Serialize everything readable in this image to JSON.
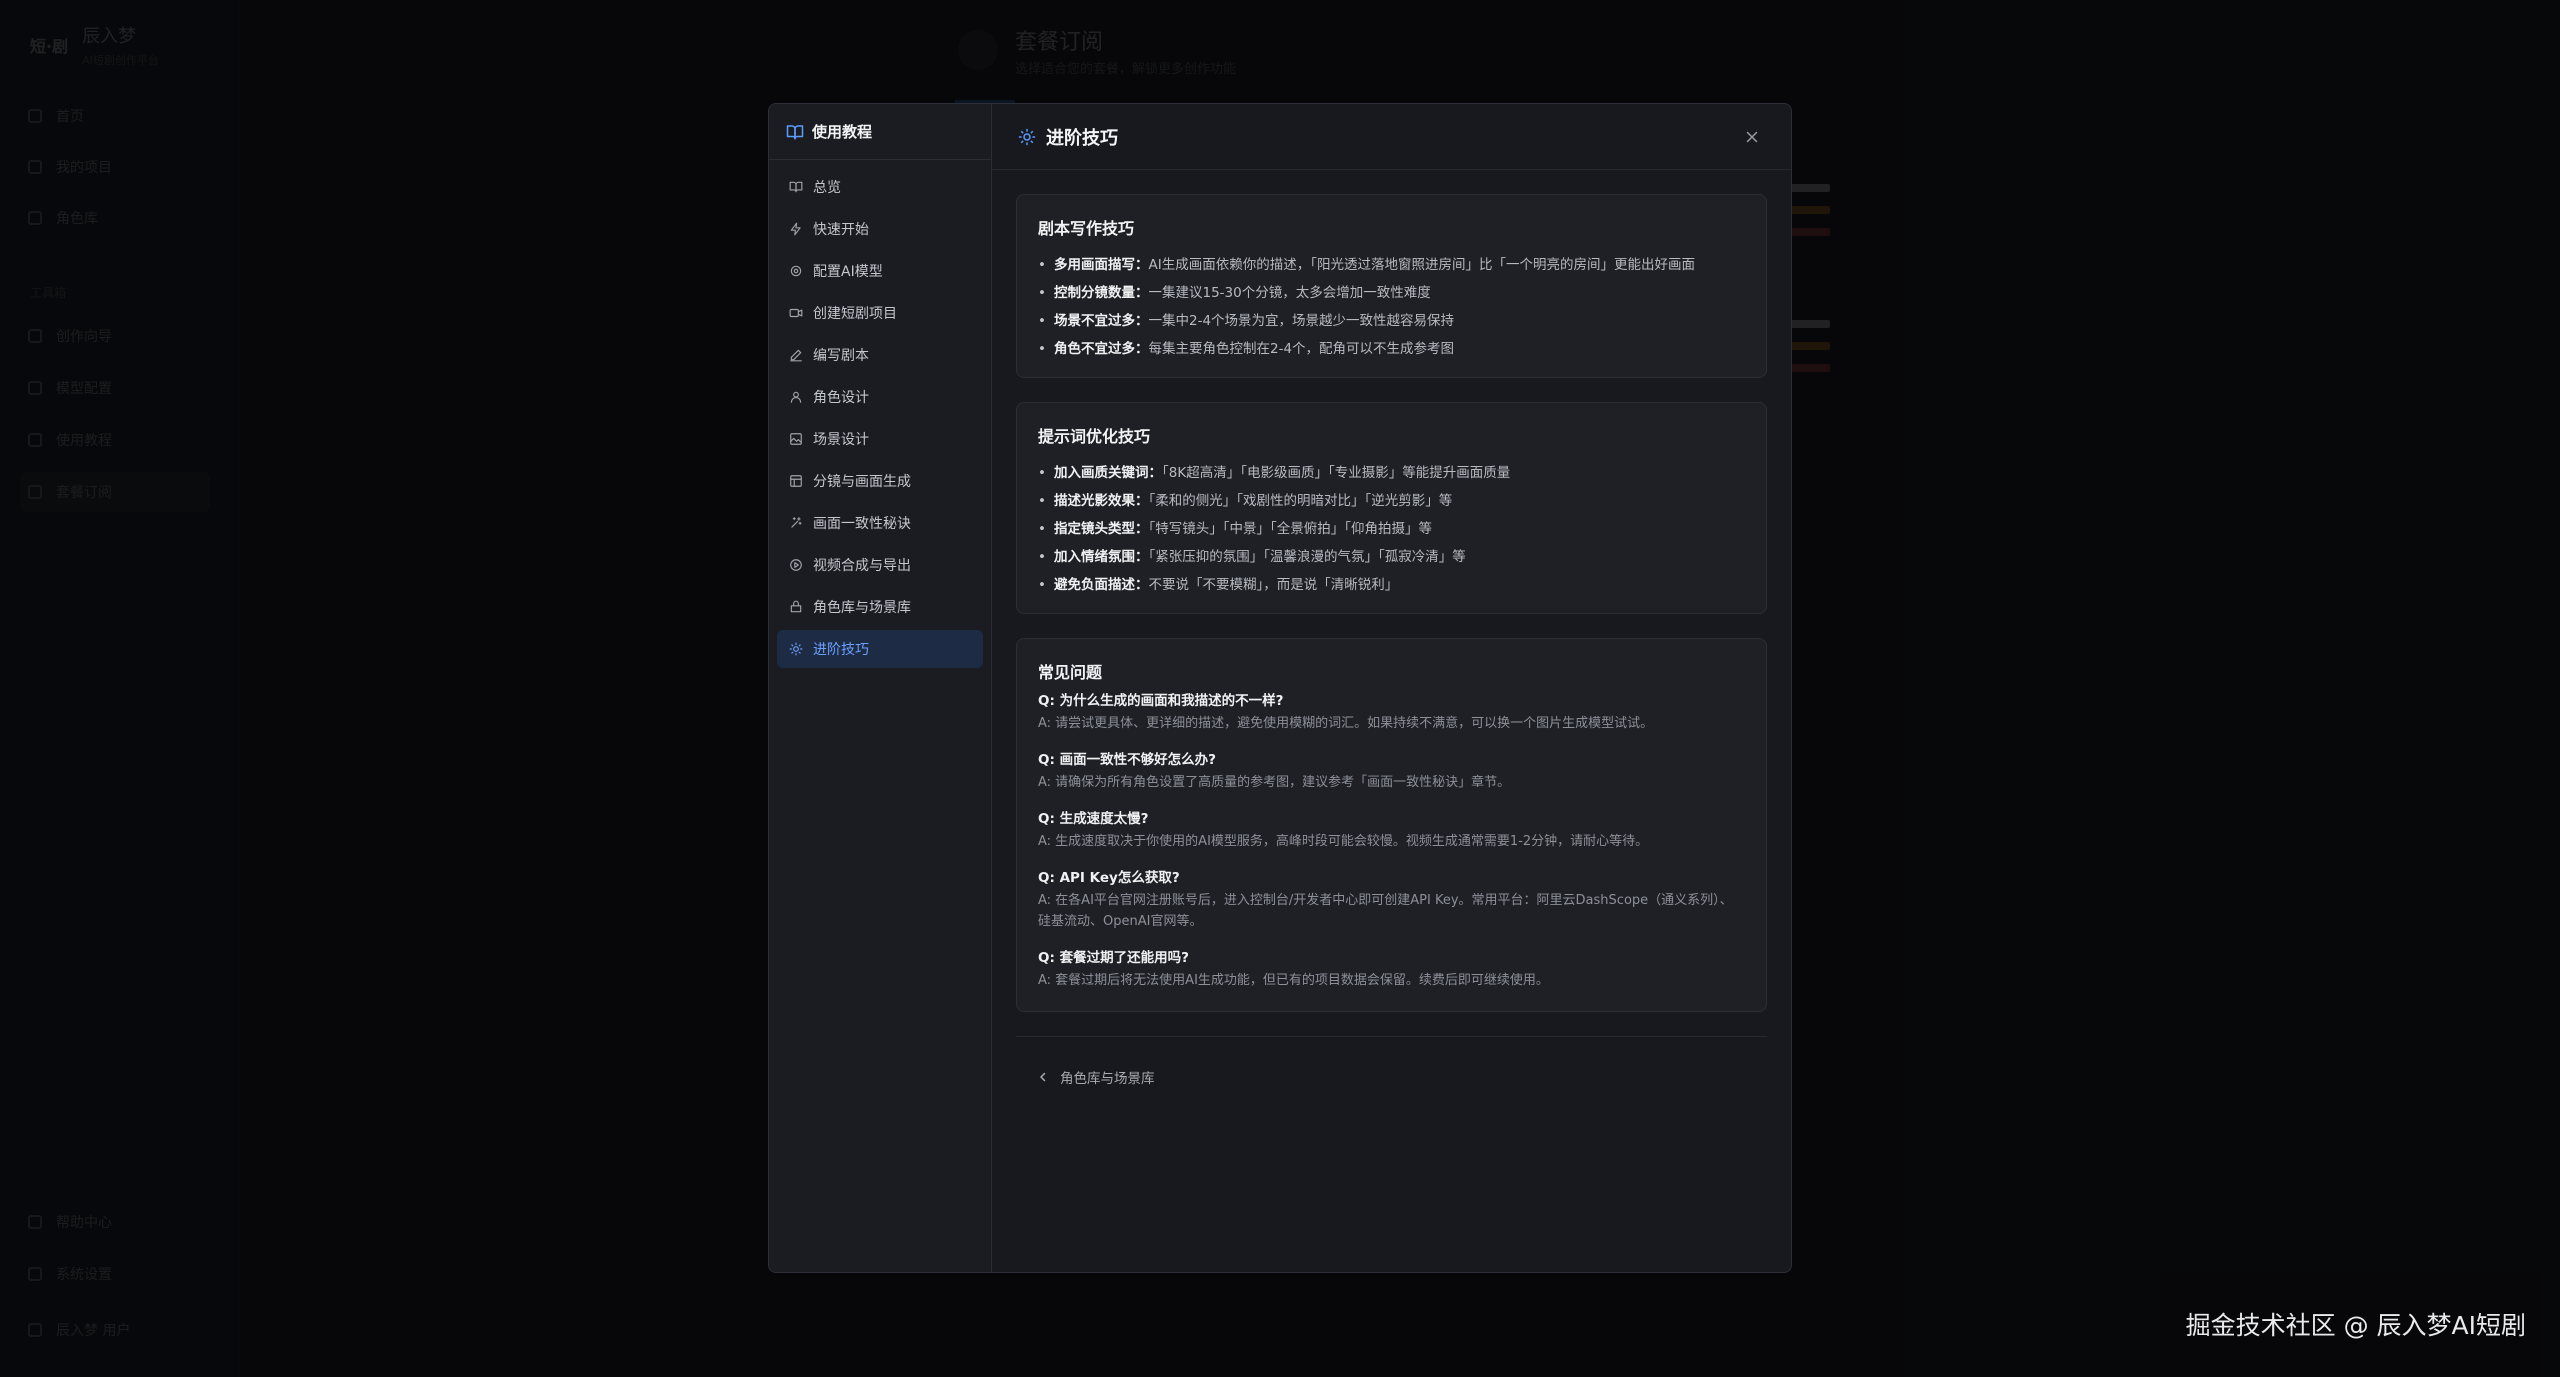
{
  "background": {
    "brand_logo": "短·剧",
    "brand_name": "辰入梦",
    "brand_sub": "AI短剧创作平台",
    "nav": [
      "首页",
      "我的项目",
      "角色库"
    ],
    "section_label": "工具箱",
    "nav2": [
      "创作向导",
      "模型配置",
      "使用教程",
      "套餐订阅"
    ],
    "bottom": [
      "帮助中心",
      "系统设置",
      "辰入梦 用户"
    ],
    "main_title": "套餐订阅",
    "main_sub": "选择适合您的套餐，解锁更多创作功能"
  },
  "modal": {
    "sidebar_title": "使用教程",
    "nav_items": [
      {
        "label": "总览",
        "icon": "book-icon"
      },
      {
        "label": "快速开始",
        "icon": "lightning-icon"
      },
      {
        "label": "配置AI模型",
        "icon": "gear-icon"
      },
      {
        "label": "创建短剧项目",
        "icon": "video-icon"
      },
      {
        "label": "编写剧本",
        "icon": "edit-icon"
      },
      {
        "label": "角色设计",
        "icon": "user-icon"
      },
      {
        "label": "场景设计",
        "icon": "image-icon"
      },
      {
        "label": "分镜与画面生成",
        "icon": "storyboard-icon"
      },
      {
        "label": "画面一致性秘诀",
        "icon": "sparkle-icon"
      },
      {
        "label": "视频合成与导出",
        "icon": "play-icon"
      },
      {
        "label": "角色库与场景库",
        "icon": "library-icon"
      },
      {
        "label": "进阶技巧",
        "icon": "lightbulb-icon",
        "active": true
      }
    ],
    "header_title": "进阶技巧",
    "sections": {
      "script": {
        "title": "剧本写作技巧",
        "tips": [
          {
            "key": "多用画面描写：",
            "text": "AI生成画面依赖你的描述，「阳光透过落地窗照进房间」比「一个明亮的房间」更能出好画面"
          },
          {
            "key": "控制分镜数量：",
            "text": "一集建议15-30个分镜，太多会增加一致性难度"
          },
          {
            "key": "场景不宜过多：",
            "text": "一集中2-4个场景为宜，场景越少一致性越容易保持"
          },
          {
            "key": "角色不宜过多：",
            "text": "每集主要角色控制在2-4个，配角可以不生成参考图"
          }
        ]
      },
      "prompt": {
        "title": "提示词优化技巧",
        "tips": [
          {
            "key": "加入画质关键词：",
            "text": "「8K超高清」「电影级画质」「专业摄影」等能提升画面质量"
          },
          {
            "key": "描述光影效果：",
            "text": "「柔和的侧光」「戏剧性的明暗对比」「逆光剪影」等"
          },
          {
            "key": "指定镜头类型：",
            "text": "「特写镜头」「中景」「全景俯拍」「仰角拍摄」等"
          },
          {
            "key": "加入情绪氛围：",
            "text": "「紧张压抑的氛围」「温馨浪漫的气氛」「孤寂冷清」等"
          },
          {
            "key": "避免负面描述：",
            "text": "不要说「不要模糊」，而是说「清晰锐利」"
          }
        ]
      },
      "faq": {
        "title": "常见问题",
        "items": [
          {
            "q": "Q: 为什么生成的画面和我描述的不一样?",
            "a": "A: 请尝试更具体、更详细的描述，避免使用模糊的词汇。如果持续不满意，可以换一个图片生成模型试试。"
          },
          {
            "q": "Q: 画面一致性不够好怎么办?",
            "a": "A: 请确保为所有角色设置了高质量的参考图，建议参考「画面一致性秘诀」章节。"
          },
          {
            "q": "Q: 生成速度太慢?",
            "a": "A: 生成速度取决于你使用的AI模型服务，高峰时段可能会较慢。视频生成通常需要1-2分钟，请耐心等待。"
          },
          {
            "q": "Q: API Key怎么获取?",
            "a": "A: 在各AI平台官网注册账号后，进入控制台/开发者中心即可创建API Key。常用平台：阿里云DashScope（通义系列）、硅基流动、OpenAI官网等。"
          },
          {
            "q": "Q: 套餐过期了还能用吗?",
            "a": "A: 套餐过期后将无法使用AI生成功能，但已有的项目数据会保留。续费后即可继续使用。"
          }
        ]
      }
    },
    "prev_link": "角色库与场景库"
  },
  "watermark": "掘金技术社区 @ 辰入梦AI短剧",
  "colors": {
    "accent": "#6ba1ff",
    "active_bg": "#1d2b45"
  }
}
